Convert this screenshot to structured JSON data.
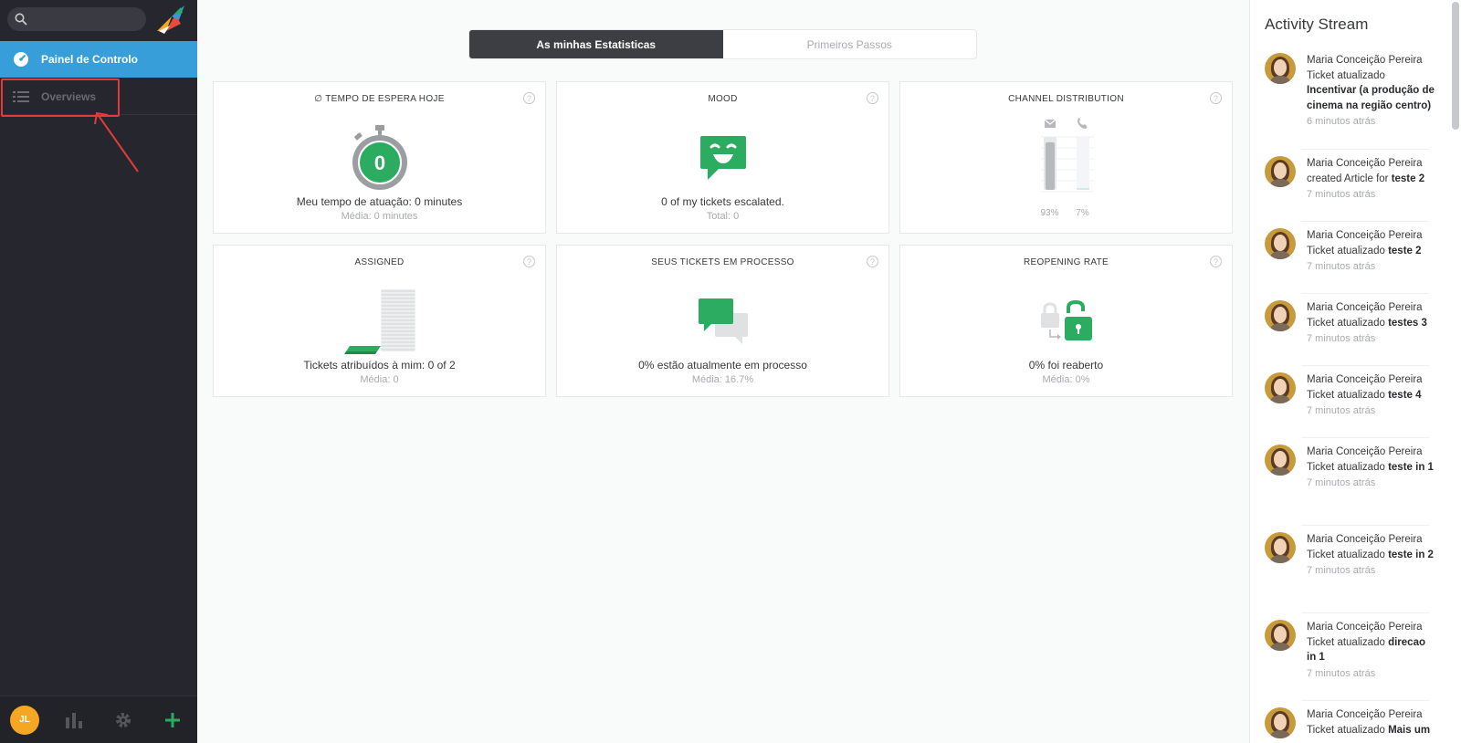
{
  "sidebar": {
    "search": {
      "placeholder": ""
    },
    "nav": [
      {
        "label": "Painel de Controlo",
        "icon": "dashboard-icon"
      },
      {
        "label": "Overviews",
        "icon": "list-icon"
      }
    ],
    "user_initials": "JL"
  },
  "tabs": [
    {
      "label": "As minhas Estatisticas",
      "active": true
    },
    {
      "label": "Primeiros Passos",
      "active": false
    }
  ],
  "widgets": {
    "waiting_time": {
      "title": "∅ Tempo de espera hoje",
      "value": "0",
      "desc": "Meu tempo de atuação: 0 minutes",
      "sub": "Média: 0 minutes"
    },
    "mood": {
      "title": "Mood",
      "desc": "0 of my tickets escalated.",
      "sub": "Total: 0"
    },
    "channel": {
      "title": "Channel Distribution",
      "email_pct": "93%",
      "phone_pct": "7%",
      "email_share": 0.93,
      "phone_share": 0.07
    },
    "assigned": {
      "title": "Assigned",
      "desc": "Tickets atribuídos à mim: 0 of 2",
      "sub": "Média: 0"
    },
    "in_process": {
      "title": "Seus tickets em processo",
      "desc": "0% estão atualmente em processo",
      "sub": "Média: 16.7%"
    },
    "reopening": {
      "title": "Reopening rate",
      "desc": "0% foi reaberto",
      "sub": "Média: 0%"
    }
  },
  "help_glyph": "?",
  "activity": {
    "title": "Activity Stream",
    "items": [
      {
        "user": "Maria Conceição Pereira",
        "action": "Ticket atualizado",
        "target": "Incentivar (a produção de cinema na região centro)",
        "time": "6 minutos atrás"
      },
      {
        "user": "Maria Conceição Pereira",
        "action": "created Article for",
        "target": "teste 2",
        "time": "7 minutos atrás"
      },
      {
        "user": "Maria Conceição Pereira",
        "action": "Ticket atualizado",
        "target": "teste 2",
        "time": "7 minutos atrás"
      },
      {
        "user": "Maria Conceição Pereira",
        "action": "Ticket atualizado",
        "target": "testes 3",
        "time": "7 minutos atrás"
      },
      {
        "user": "Maria Conceição Pereira",
        "action": "Ticket atualizado",
        "target": "teste 4",
        "time": "7 minutos atrás"
      },
      {
        "user": "Maria Conceição Pereira",
        "action": "Ticket atualizado",
        "target": "teste in 1",
        "time": "7 minutos atrás"
      },
      {
        "user": "Maria Conceição Pereira",
        "action": "Ticket atualizado",
        "target": "teste in 2",
        "time": "7 minutos atrás"
      },
      {
        "user": "Maria Conceição Pereira",
        "action": "Ticket atualizado",
        "target": "direcao in 1",
        "time": "7 minutos atrás"
      },
      {
        "user": "Maria Conceição Pereira",
        "action": "Ticket atualizado",
        "target": "Mais um",
        "time": ""
      }
    ]
  },
  "colors": {
    "accent": "#389ed9",
    "green": "#2bac60",
    "sidebar": "#26272e",
    "highlight": "#e33b3b"
  }
}
